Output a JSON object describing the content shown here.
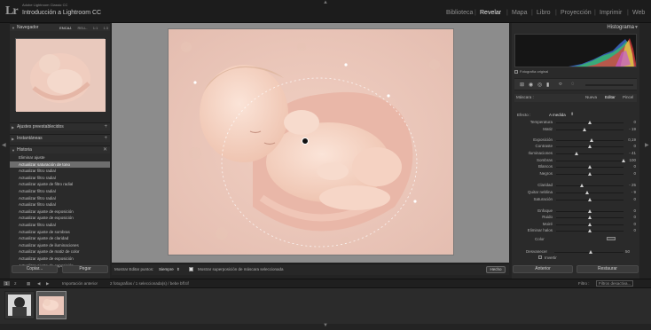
{
  "header": {
    "logo": "Lr",
    "catalog_label": "Adobe Lightroom Classic CC",
    "catalog_name": "Introducción a Lightroom CC",
    "modules": [
      "Biblioteca",
      "Revelar",
      "Mapa",
      "Libro",
      "Proyección",
      "Imprimir",
      "Web"
    ],
    "active_module": "Revelar"
  },
  "left_panel": {
    "navigator": {
      "title": "Navegador",
      "zoom_options": [
        "ENCAJ.",
        "RELL.",
        "1:1",
        "1:3"
      ]
    },
    "presets": "Ajustes preestablecidos",
    "snapshots": "Instantáneas",
    "history": {
      "title": "Historia",
      "items": [
        "Eliminar ajuste",
        "Actualizar saturación de tono",
        "Actualizar filtro radial",
        "Actualizar filtro radial",
        "Actualizar ajuste de filtro radial",
        "Actualizar filtro radial",
        "Actualizar filtro radial",
        "Actualizar filtro radial",
        "Actualizar ajuste de exposición",
        "Actualizar ajuste de exposición",
        "Actualizar filtro radial",
        "Actualizar ajuste de sombras",
        "Actualizar ajuste de claridad",
        "Actualizar ajuste de iluminaciones",
        "Actualizar ajuste de matiz de color",
        "Actualizar ajuste de exposición",
        "Actualizar ajuste de exposición"
      ],
      "selected_index": 1
    },
    "copy_button": "Copiar...",
    "paste_button": "Pegar"
  },
  "toolbar": {
    "show_pins_label": "Mostrar Editar puntos:",
    "show_pins_value": "Siempre",
    "overlay_label": "Mostrar superposición de máscara seleccionada",
    "done_button": "Hecho"
  },
  "right_panel": {
    "histogram_title": "Histograma",
    "original_photo": "Fotografía original",
    "mask_label": "Máscara :",
    "mask_new": "Nueva",
    "mask_edit": "Editar",
    "mask_brush": "Pincel",
    "effect_label": "Efecto :",
    "effect_value": "A medida",
    "sliders": [
      {
        "label": "Temperatura",
        "value": "0",
        "pos": 0.5
      },
      {
        "label": "Matiz",
        "value": "- 19",
        "pos": 0.42
      },
      {
        "label": "Exposición",
        "value": "0,19",
        "pos": 0.53
      },
      {
        "label": "Contraste",
        "value": "0",
        "pos": 0.5
      },
      {
        "label": "Iluminaciones",
        "value": "- 41",
        "pos": 0.3
      },
      {
        "label": "Sombras",
        "value": "100",
        "pos": 1.0
      },
      {
        "label": "Blancos",
        "value": "0",
        "pos": 0.5
      },
      {
        "label": "Negros",
        "value": "0",
        "pos": 0.5
      },
      {
        "label": "Claridad",
        "value": "- 25",
        "pos": 0.38
      },
      {
        "label": "Quitar neblina",
        "value": "- 9",
        "pos": 0.46
      },
      {
        "label": "Saturación",
        "value": "0",
        "pos": 0.5
      },
      {
        "label": "Enfoque",
        "value": "0",
        "pos": 0.5
      },
      {
        "label": "Ruido",
        "value": "0",
        "pos": 0.5
      },
      {
        "label": "Moiré",
        "value": "0",
        "pos": 0.5
      },
      {
        "label": "Eliminar halos",
        "value": "0",
        "pos": 0.5
      }
    ],
    "color_label": "Color",
    "feather_label": "Desvanecer",
    "feather_value": "50",
    "invert_label": "Invertir",
    "previous_button": "Anterior",
    "reset_button": "Restaurar"
  },
  "filmstrip": {
    "page_numbers": [
      "1",
      "2"
    ],
    "source": "Importación anterior",
    "info": "2 fotografías / 1 seleccionada(s) / bebe bff.tif",
    "filter_label": "Filtro :",
    "filter_value": "Filtros desactiva..."
  }
}
